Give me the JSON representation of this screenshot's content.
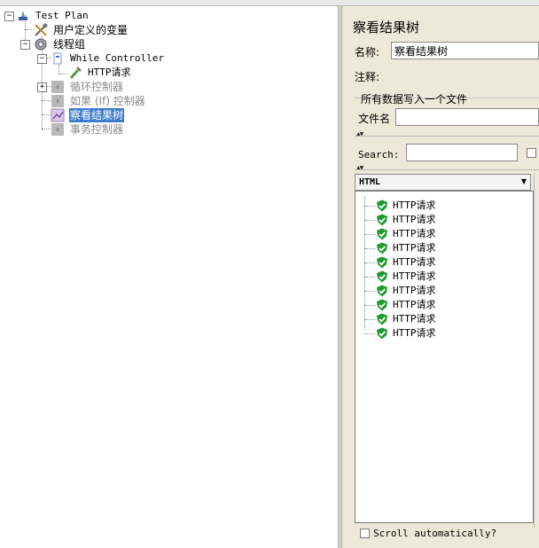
{
  "colors": {
    "selection": "#3d7ccc",
    "panel_bg": "#ece9d8",
    "success_icon": "#1f9a2f"
  },
  "tree": {
    "items": [
      {
        "label": "Test Plan",
        "icon": "test-plan-icon"
      },
      {
        "label": "用户定义的变量",
        "icon": "wrench-scissors-icon"
      },
      {
        "label": "线程组",
        "icon": "gear-icon"
      },
      {
        "label": "While Controller",
        "icon": "controller-icon"
      },
      {
        "label": "HTTP请求",
        "icon": "pipette-icon"
      },
      {
        "label": "循环控制器",
        "icon": "disabled-controller-icon"
      },
      {
        "label": "如果 (If) 控制器",
        "icon": "disabled-controller-icon"
      },
      {
        "label": "察看结果树",
        "icon": "listener-graph-icon",
        "selected": true
      },
      {
        "label": "事务控制器",
        "icon": "disabled-controller-icon"
      }
    ]
  },
  "panel": {
    "title": "察看结果树",
    "name_label": "名称:",
    "name_value": "察看结果树",
    "comment_label": "注释:",
    "comment_value": "",
    "file_section_title": "所有数据写入一个文件",
    "filename_label": "文件名",
    "filename_value": "",
    "search_label": "Search:",
    "search_value": "",
    "renderer": "HTML",
    "results": [
      "HTTP请求",
      "HTTP请求",
      "HTTP请求",
      "HTTP请求",
      "HTTP请求",
      "HTTP请求",
      "HTTP请求",
      "HTTP请求",
      "HTTP请求",
      "HTTP请求"
    ],
    "scroll_auto_label": "Scroll automatically?"
  }
}
